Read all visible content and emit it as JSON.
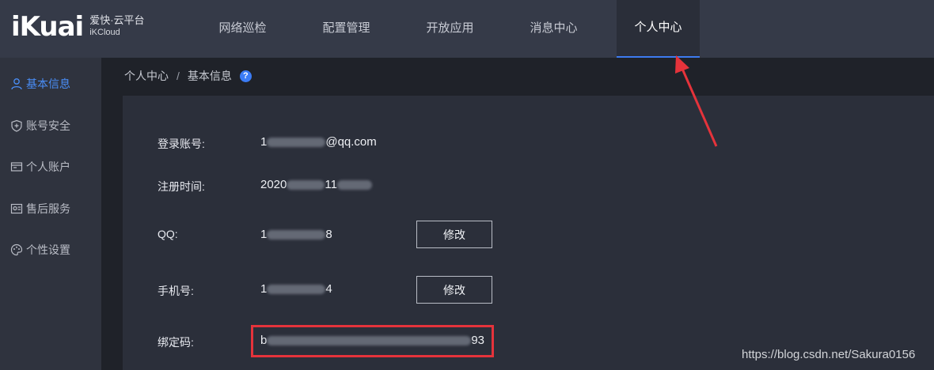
{
  "brand": {
    "logo": "iKuai",
    "name_cn": "爱快·云平台",
    "name_en": "iKCloud"
  },
  "nav": {
    "items": [
      {
        "label": "网络巡检"
      },
      {
        "label": "配置管理"
      },
      {
        "label": "开放应用"
      },
      {
        "label": "消息中心"
      },
      {
        "label": "个人中心",
        "active": true
      }
    ]
  },
  "sidebar": {
    "items": [
      {
        "label": "基本信息",
        "icon": "user-icon",
        "active": true
      },
      {
        "label": "账号安全",
        "icon": "shield-plus-icon"
      },
      {
        "label": "个人账户",
        "icon": "wallet-icon"
      },
      {
        "label": "售后服务",
        "icon": "service-icon"
      },
      {
        "label": "个性设置",
        "icon": "palette-icon"
      }
    ]
  },
  "breadcrumb": {
    "parent": "个人中心",
    "separator": "/",
    "current": "基本信息",
    "help": "?"
  },
  "profile": {
    "login_account": {
      "label": "登录账号:",
      "value_prefix": "1",
      "value_suffix": "@qq.com"
    },
    "register_time": {
      "label": "注册时间:",
      "value_prefix": "2020",
      "value_mid": "11"
    },
    "qq": {
      "label": "QQ:",
      "value_prefix": "1",
      "value_suffix": "8",
      "button": "修改"
    },
    "phone": {
      "label": "手机号:",
      "value_prefix": "1",
      "value_suffix": "4",
      "button": "修改"
    },
    "bind_code": {
      "label": "绑定码:",
      "value_prefix": "b",
      "value_suffix": "93"
    }
  },
  "watermark": "https://blog.csdn.net/Sakura0156",
  "colors": {
    "accent": "#3d7bf0",
    "annotation": "#e5333b",
    "topbar": "#353a48",
    "sidebar": "#2f333e",
    "panel": "#2b2f3a"
  }
}
